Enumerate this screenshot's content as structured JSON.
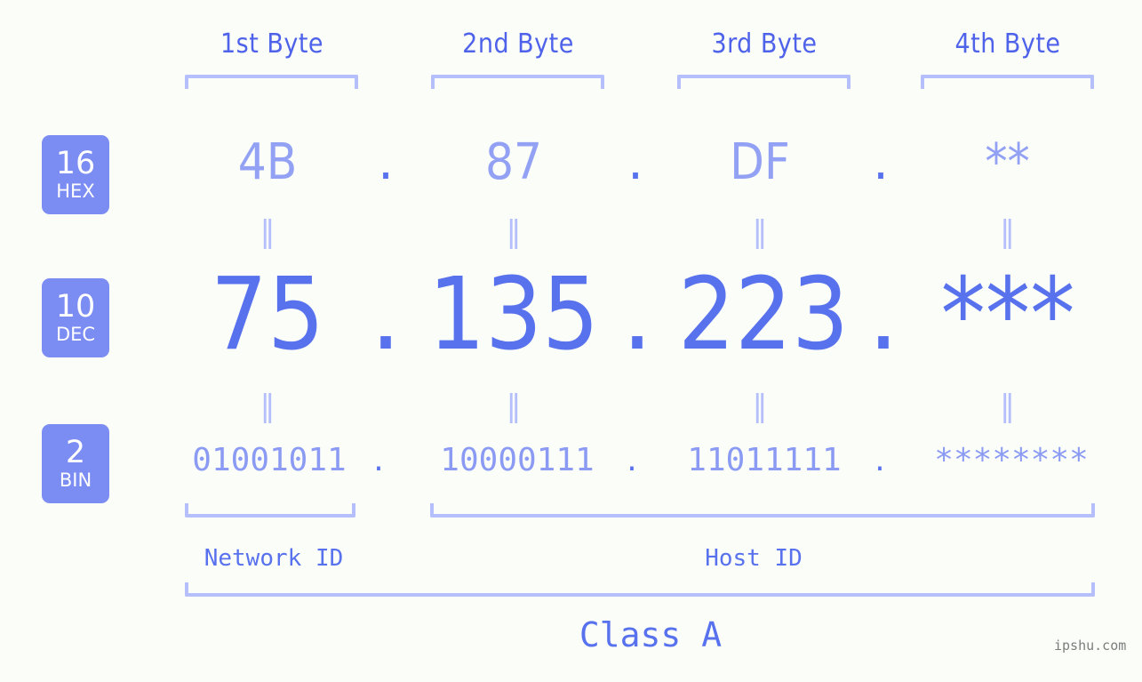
{
  "background_color": "#fbfdf9",
  "accent_color": "#5872ee",
  "accent_light_color": "#93a1f4",
  "bracket_color": "#b5bffb",
  "badge_color": "#7b8cf2",
  "headers": {
    "byte1": "1st Byte",
    "byte2": "2nd Byte",
    "byte3": "3rd Byte",
    "byte4": "4th Byte"
  },
  "bases": {
    "hex": {
      "number": "16",
      "name": "HEX"
    },
    "dec": {
      "number": "10",
      "name": "DEC"
    },
    "bin": {
      "number": "2",
      "name": "BIN"
    }
  },
  "separator": "‖",
  "dot": ".",
  "rows": {
    "hex": {
      "byte1": "4B",
      "byte2": "87",
      "byte3": "DF",
      "byte4": "**"
    },
    "dec": {
      "byte1": "75",
      "byte2": "135",
      "byte3": "223",
      "byte4": "***"
    },
    "bin": {
      "byte1": "01001011",
      "byte2": "10000111",
      "byte3": "11011111",
      "byte4": "********"
    }
  },
  "sections": {
    "network_id": "Network ID",
    "host_id": "Host ID",
    "class": "Class A"
  },
  "watermark": "ipshu.com"
}
